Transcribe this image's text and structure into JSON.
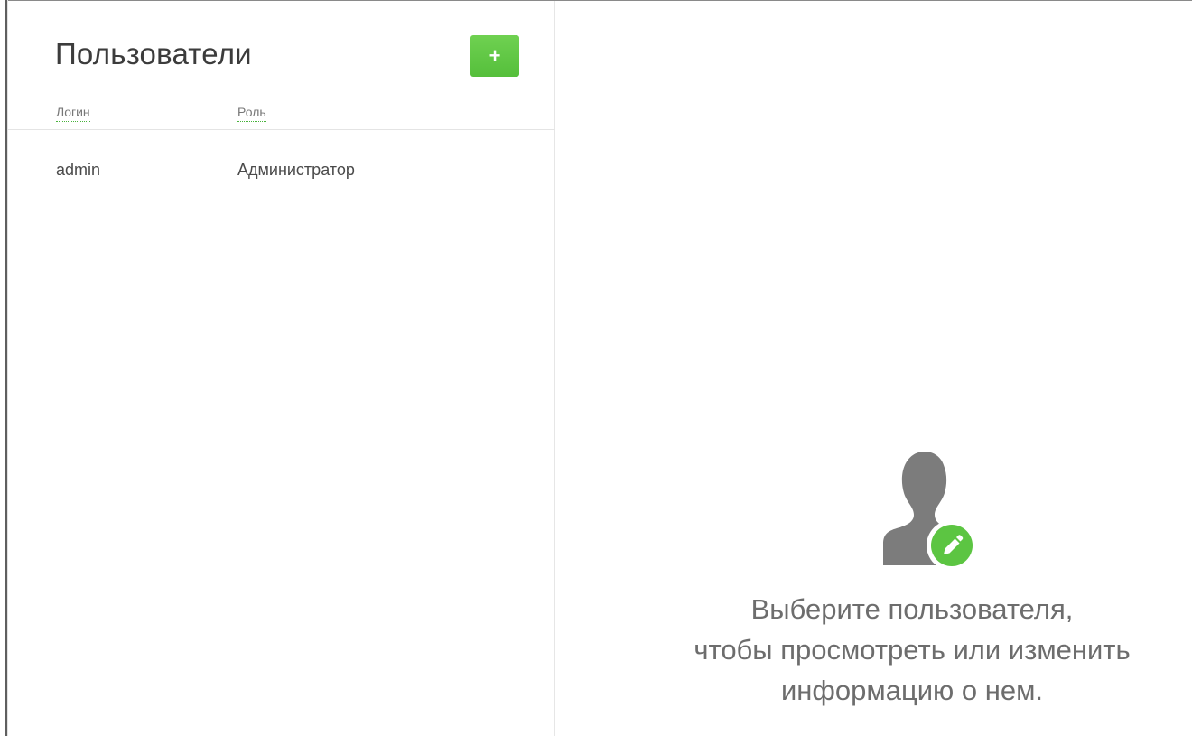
{
  "users_panel": {
    "title": "Пользователи",
    "add_button_label": "+",
    "columns": {
      "login": "Логин",
      "role": "Роль"
    },
    "rows": [
      {
        "login": "admin",
        "role": "Администратор"
      }
    ]
  },
  "details_panel": {
    "icon": "user-edit-icon",
    "message_lines": [
      "Выберите пользователя,",
      "чтобы просмотреть или изменить",
      "информацию о нем."
    ]
  },
  "colors": {
    "accent": "#5cc542",
    "icon_gray": "#7c7c7c",
    "text": "#4a4a4a"
  }
}
